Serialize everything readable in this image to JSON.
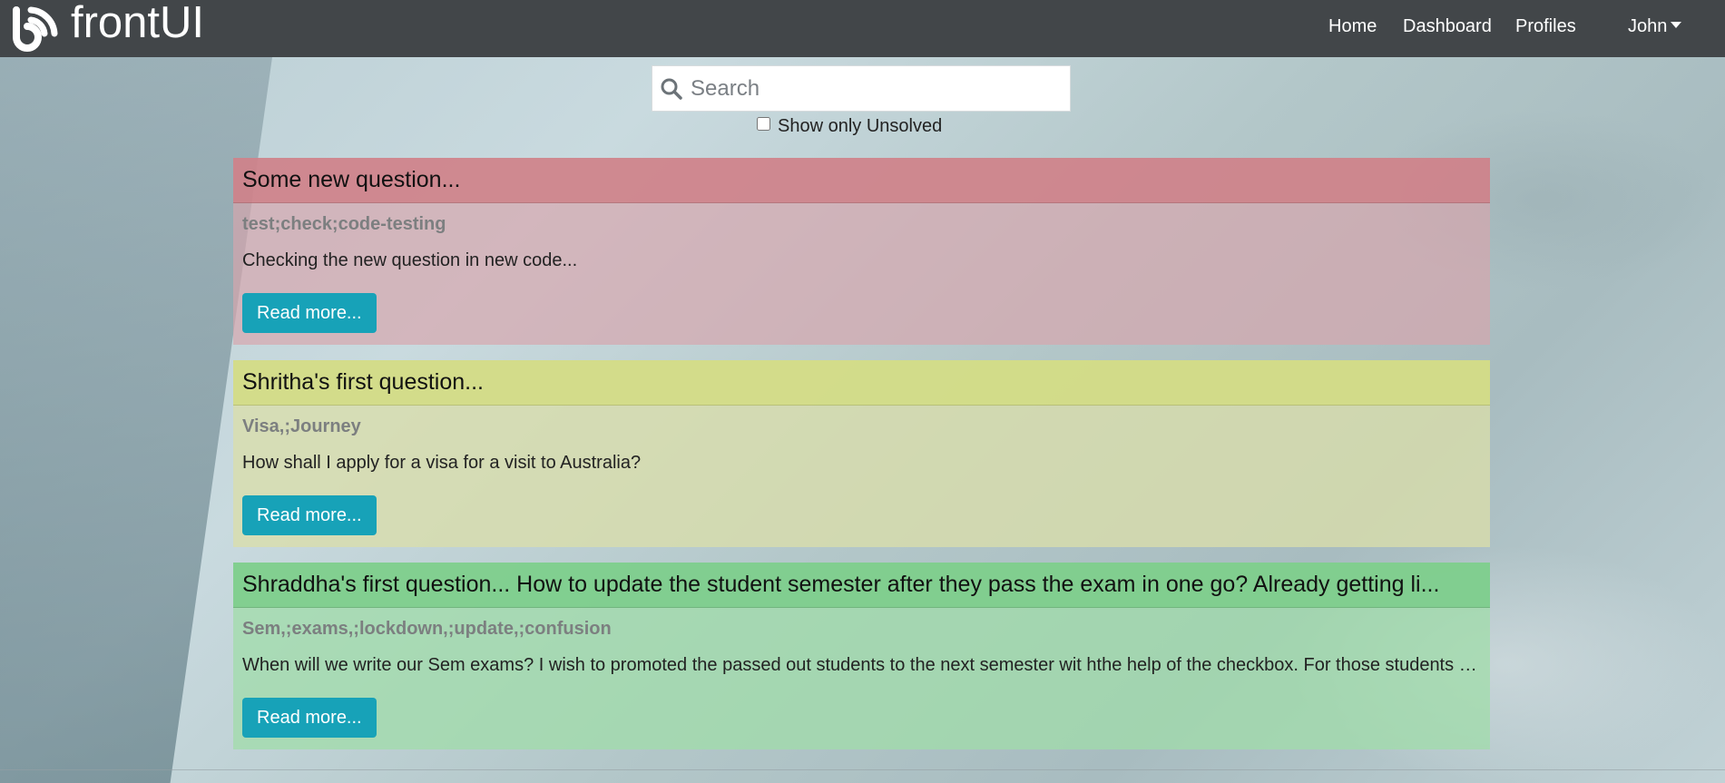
{
  "navbar": {
    "brand": "frontUI",
    "links": [
      "Home",
      "Dashboard",
      "Profiles"
    ],
    "user": "John"
  },
  "search": {
    "placeholder": "Search",
    "value": ""
  },
  "filter": {
    "label": "Show only Unsolved",
    "checked": false
  },
  "questions": [
    {
      "title": "Some new question...",
      "tags": "test;check;code-testing",
      "text": "Checking the new question in new code...",
      "button": "Read more...",
      "status_color": "#cd7982"
    },
    {
      "title": "Shritha's first question...",
      "tags": "Visa,;Journey",
      "text": "How shall I apply for a visa for a visit to Australia?",
      "button": "Read more...",
      "status_color": "#d2dc82"
    },
    {
      "title": "Shraddha's first question... How to update the student semester after they pass the exam in one go? Already getting li...",
      "tags": "Sem,;exams,;lockdown,;update,;confusion",
      "text": "When will we write our Sem exams? I wish to promoted the passed out students to the next semester wit hthe help of the checkbox. For those students c...",
      "button": "Read more...",
      "status_color": "#7dcd8c"
    }
  ],
  "colors": {
    "navbar_bg": "#424649",
    "button_bg": "#17a2b8"
  }
}
